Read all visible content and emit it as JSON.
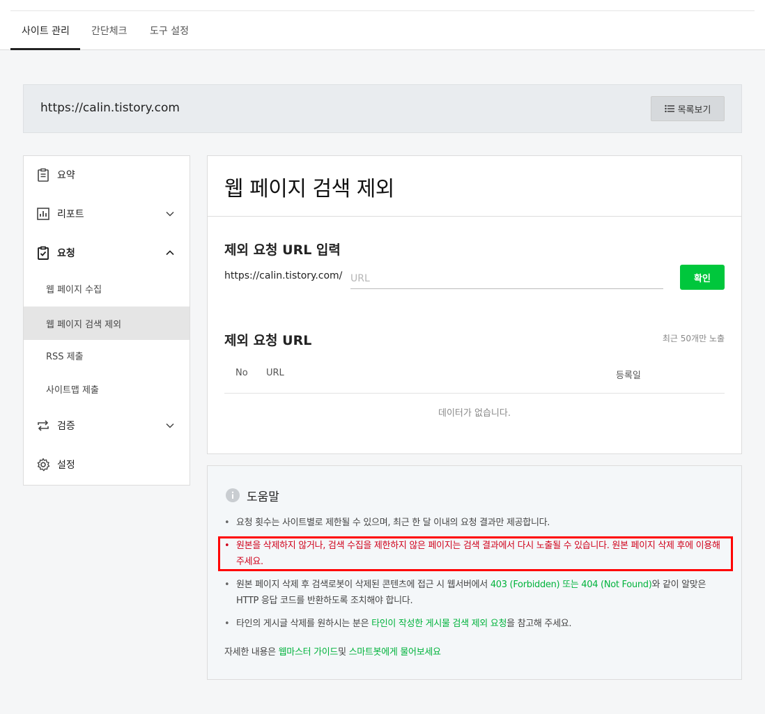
{
  "tabs": [
    {
      "label": "사이트 관리",
      "active": true
    },
    {
      "label": "간단체크",
      "active": false
    },
    {
      "label": "도구 설정",
      "active": false
    }
  ],
  "site": {
    "url": "https://calin.tistory.com",
    "list_button": "목록보기"
  },
  "sidebar": {
    "items": [
      {
        "label": "요약",
        "icon": "clipboard-icon"
      },
      {
        "label": "리포트",
        "icon": "chart-icon"
      },
      {
        "label": "요청",
        "icon": "clipboard-check-icon"
      },
      {
        "label": "검증",
        "icon": "repeat-icon"
      },
      {
        "label": "설정",
        "icon": "gear-icon"
      }
    ],
    "subitems": [
      {
        "label": "웹 페이지 수집",
        "selected": false
      },
      {
        "label": "웹 페이지 검색 제외",
        "selected": true
      },
      {
        "label": "RSS 제출",
        "selected": false
      },
      {
        "label": "사이트맵 제출",
        "selected": false
      }
    ]
  },
  "main": {
    "title": "웹 페이지 검색 제외",
    "input_section": {
      "heading": "제외 요청 URL 입력",
      "prefix": "https://calin.tistory.com/",
      "placeholder": "URL",
      "value": "",
      "confirm": "확인"
    },
    "list_section": {
      "heading": "제외 요청 URL",
      "note": "최근 50개만 노출",
      "columns": [
        "No",
        "URL",
        "등록일"
      ],
      "empty": "데이터가 없습니다."
    }
  },
  "help": {
    "title": "도움말",
    "items": [
      {
        "text": "요청 횟수는 사이트별로 제한될 수 있으며, 최근 한 달 이내의 요청 결과만 제공합니다."
      },
      {
        "text": "원본을 삭제하지 않거나, 검색 수집을 제한하지 않은 페이지는 검색 결과에서 다시 노출될 수 있습니다. 원본 페이지 삭제 후에 이용해 주세요."
      },
      {
        "before": "원본 페이지 삭제 후 검색로봇이 삭제된 콘텐츠에 접근 시 웹서버에서 ",
        "link": "403 (Forbidden) 또는 404 (Not Found)",
        "after": "와 같이 알맞은 HTTP 응답 코드를 반환하도록 조치해야 합니다."
      },
      {
        "before": "타인의 게시글 삭제를 원하시는 분은 ",
        "link": "타인이 작성한 게시물 검색 제외 요청",
        "after": "을 참고해 주세요."
      }
    ],
    "footer": {
      "before": "자세한 내용은 ",
      "link1": "웹마스터 가이드",
      "middle": "및 ",
      "link2": "스마트봇에게 물어보세요"
    }
  },
  "colors": {
    "accent_green": "#00c73c",
    "link_green": "#00b33c",
    "warning_red": "#d0021b",
    "highlight_border": "#ff0000"
  }
}
